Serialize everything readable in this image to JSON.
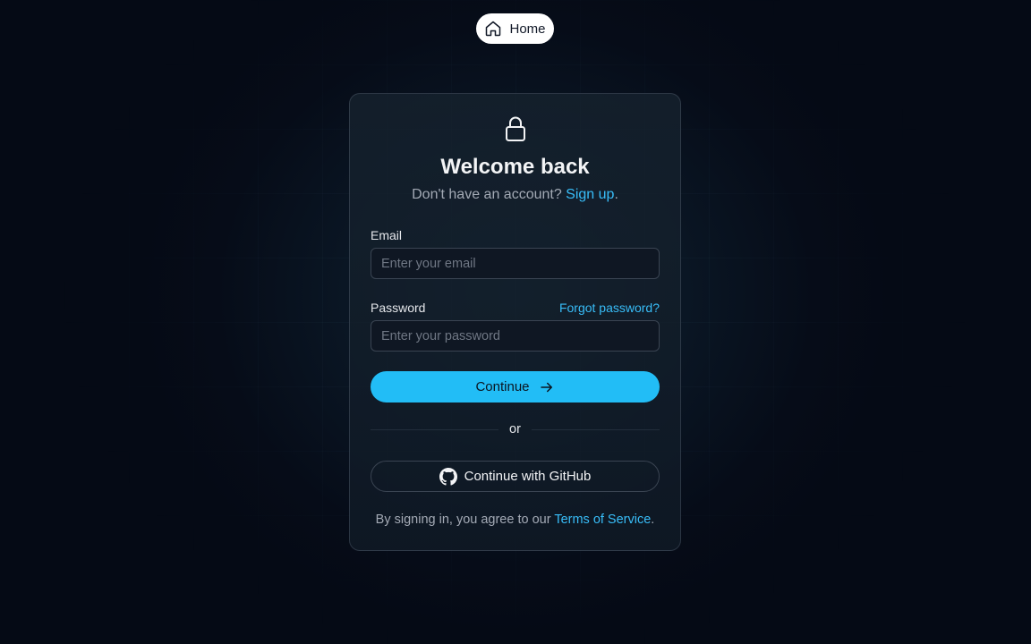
{
  "nav": {
    "home_label": "Home"
  },
  "card": {
    "title": "Welcome back",
    "subtitle_prefix": "Don't have an account? ",
    "signup_link": "Sign up",
    "subtitle_suffix": ".",
    "email_label": "Email",
    "email_placeholder": "Enter your email",
    "email_value": "",
    "password_label": "Password",
    "forgot_link": "Forgot password?",
    "password_placeholder": "Enter your password",
    "password_value": "",
    "continue_label": "Continue",
    "divider_text": "or",
    "github_label": "Continue with GitHub",
    "terms_prefix": "By signing in, you agree to our ",
    "terms_link": "Terms of Service",
    "terms_suffix": "."
  },
  "icons": {
    "home": "home-icon",
    "lock": "lock-icon",
    "arrow": "arrow-right-icon",
    "github": "github-icon"
  },
  "colors": {
    "accent": "#22bdf6",
    "link": "#38bdf8",
    "background": "#060c18"
  }
}
